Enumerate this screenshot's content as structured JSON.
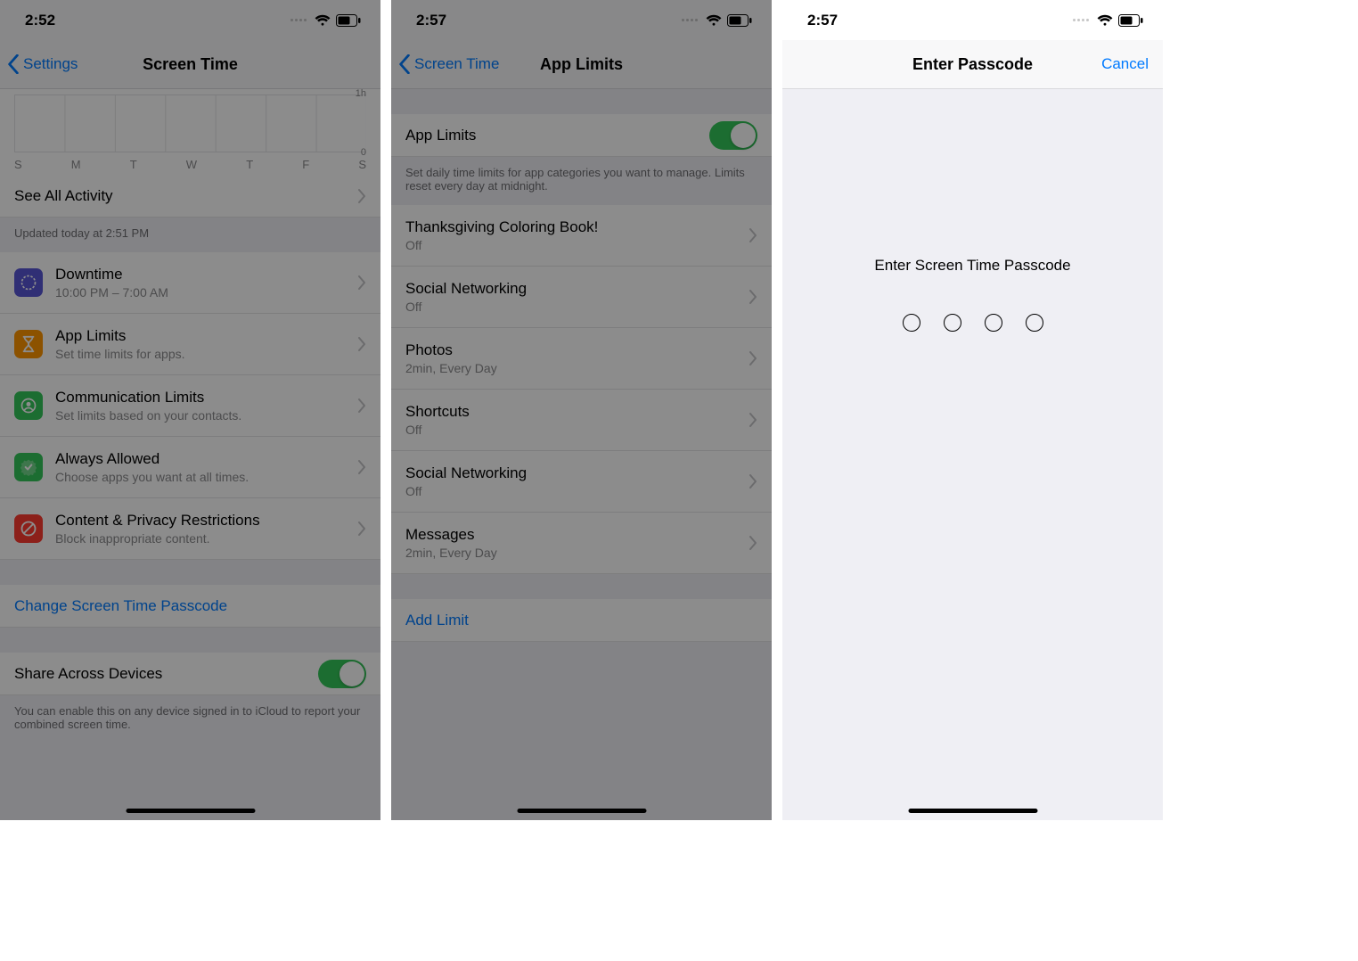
{
  "screen1": {
    "time": "2:52",
    "back": "Settings",
    "title": "Screen Time",
    "chart": {
      "labels": [
        "S",
        "M",
        "T",
        "W",
        "T",
        "F",
        "S"
      ],
      "max": "1h",
      "min": "0"
    },
    "seeAll": "See All Activity",
    "updated": "Updated today at 2:51 PM",
    "rows": [
      {
        "title": "Downtime",
        "sub": "10:00 PM – 7:00 AM",
        "color": "#5856d6",
        "icon": "moon"
      },
      {
        "title": "App Limits",
        "sub": "Set time limits for apps.",
        "color": "#ff9500",
        "icon": "hourglass"
      },
      {
        "title": "Communication Limits",
        "sub": "Set limits based on your contacts.",
        "color": "#34c759",
        "icon": "person"
      },
      {
        "title": "Always Allowed",
        "sub": "Choose apps you want at all times.",
        "color": "#34c759",
        "icon": "check"
      },
      {
        "title": "Content & Privacy Restrictions",
        "sub": "Block inappropriate content.",
        "color": "#ff3b30",
        "icon": "nosign"
      }
    ],
    "changePasscode": "Change Screen Time Passcode",
    "share": "Share Across Devices",
    "shareDesc": "You can enable this on any device signed in to iCloud to report your combined screen time."
  },
  "screen2": {
    "time": "2:57",
    "back": "Screen Time",
    "title": "App Limits",
    "toggleLabel": "App Limits",
    "desc": "Set daily time limits for app categories you want to manage. Limits reset every day at midnight.",
    "limits": [
      {
        "title": "Thanksgiving Coloring Book!",
        "sub": "Off"
      },
      {
        "title": "Social Networking",
        "sub": "Off"
      },
      {
        "title": "Photos",
        "sub": "2min, Every Day"
      },
      {
        "title": "Shortcuts",
        "sub": "Off"
      },
      {
        "title": "Social Networking",
        "sub": "Off"
      },
      {
        "title": "Messages",
        "sub": "2min, Every Day"
      }
    ],
    "addLimit": "Add Limit"
  },
  "screen3": {
    "time": "2:57",
    "title": "Enter Passcode",
    "cancel": "Cancel",
    "prompt": "Enter Screen Time Passcode"
  }
}
